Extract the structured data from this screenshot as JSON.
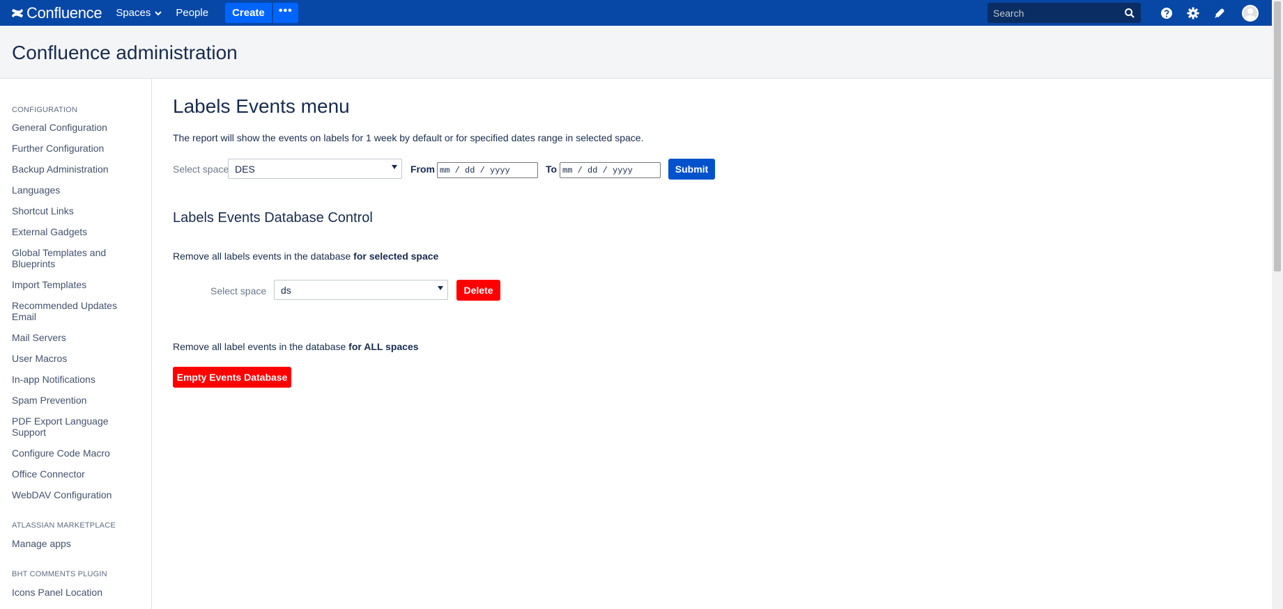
{
  "topnav": {
    "logo_text": "Confluence",
    "spaces_label": "Spaces",
    "people_label": "People",
    "create_label": "Create",
    "more_label": "•••",
    "search_placeholder": "Search"
  },
  "header": {
    "title": "Confluence administration"
  },
  "sidebar": {
    "sections": [
      {
        "heading": "CONFIGURATION"
      },
      {
        "heading": "ATLASSIAN MARKETPLACE"
      },
      {
        "heading": "BHT COMMENTS PLUGIN"
      }
    ],
    "items": [
      "General Configuration",
      "Further Configuration",
      "Backup Administration",
      "Languages",
      "Shortcut Links",
      "External Gadgets",
      "Global Templates and Blueprints",
      "Import Templates",
      "Recommended Updates Email",
      "Mail Servers",
      "User Macros",
      "In-app Notifications",
      "Spam Prevention",
      "PDF Export Language Support",
      "Configure Code Macro",
      "Office Connector",
      "WebDAV Configuration",
      "Manage apps",
      "Icons Panel Location"
    ]
  },
  "main": {
    "title": "Labels Events menu",
    "description": "The report will show the events on labels for 1 week by default or for specified dates range in selected space.",
    "report_form": {
      "select_space_label": "Select space",
      "selected_space": "DES",
      "from_label": "From",
      "from_placeholder": "mm / dd / yyyy",
      "to_label": "To",
      "to_placeholder": "mm / dd / yyyy",
      "submit_label": "Submit"
    },
    "db_control": {
      "heading": "Labels Events Database Control",
      "remove_selected_text": "Remove all labels events in the database",
      "remove_selected_bold": "for selected space",
      "select_space_label": "Select space",
      "selected_space": "ds",
      "delete_label": "Delete",
      "remove_all_text": "Remove all label events in the database",
      "remove_all_bold": "for ALL spaces",
      "empty_label": "Empty Events Database"
    }
  },
  "colors": {
    "nav_bg": "#0747a6",
    "primary": "#0052cc",
    "danger": "#ff0000"
  }
}
